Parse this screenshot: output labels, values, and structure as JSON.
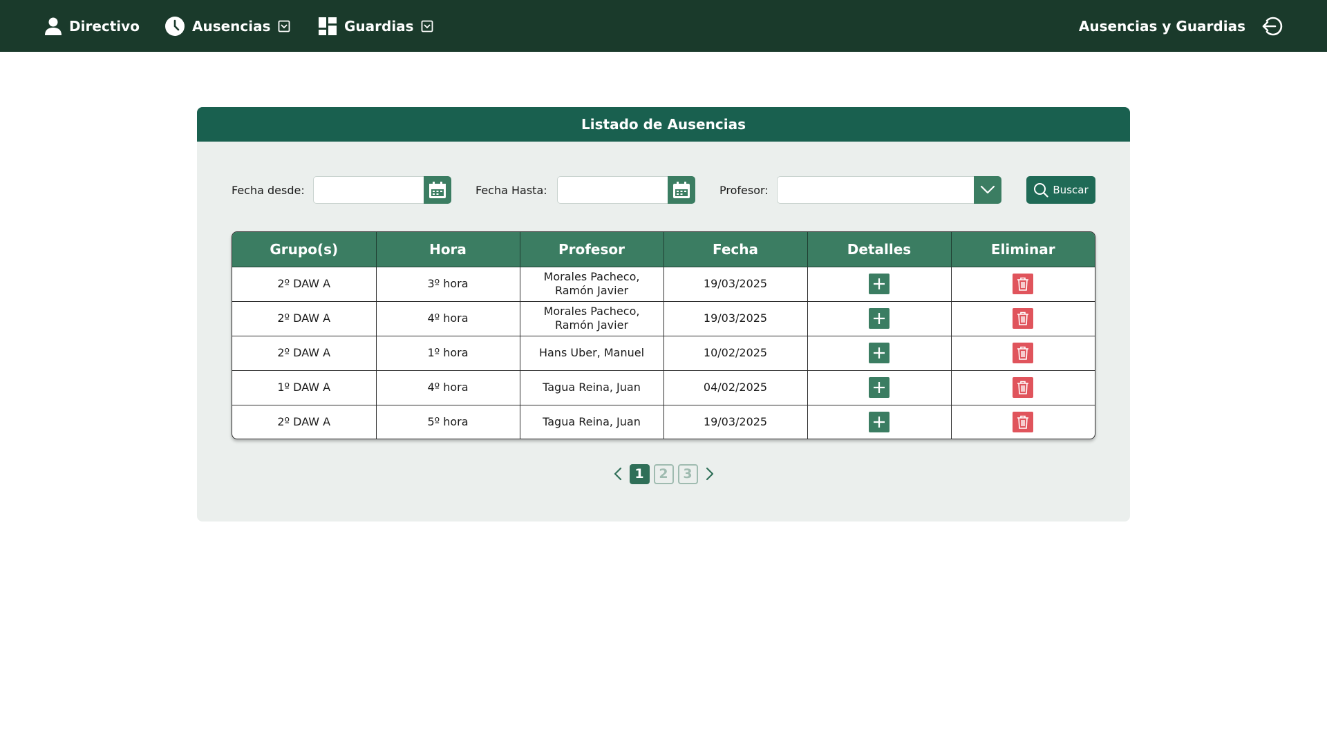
{
  "nav": {
    "directivo": "Directivo",
    "ausencias": "Ausencias",
    "guardias": "Guardias",
    "app_title": "Ausencias y Guardias"
  },
  "panel": {
    "title": "Listado de Ausencias"
  },
  "filters": {
    "fecha_desde_label": "Fecha desde:",
    "fecha_desde_value": "",
    "fecha_hasta_label": "Fecha Hasta:",
    "fecha_hasta_value": "",
    "profesor_label": "Profesor:",
    "profesor_value": "",
    "search_label": "Buscar"
  },
  "table": {
    "headers": [
      "Grupo(s)",
      "Hora",
      "Profesor",
      "Fecha",
      "Detalles",
      "Eliminar"
    ],
    "rows": [
      {
        "grupo": "2º DAW A",
        "hora": "3º hora",
        "profesor": "Morales Pacheco, Ramón Javier",
        "fecha": "19/03/2025"
      },
      {
        "grupo": "2º DAW A",
        "hora": "4º hora",
        "profesor": "Morales Pacheco, Ramón Javier",
        "fecha": "19/03/2025"
      },
      {
        "grupo": "2º DAW A",
        "hora": "1º hora",
        "profesor": "Hans Uber, Manuel",
        "fecha": "10/02/2025"
      },
      {
        "grupo": "1º DAW A",
        "hora": "4º hora",
        "profesor": "Tagua Reina, Juan",
        "fecha": "04/02/2025"
      },
      {
        "grupo": "2º DAW A",
        "hora": "5º hora",
        "profesor": "Tagua Reina, Juan",
        "fecha": "19/03/2025"
      }
    ]
  },
  "pagination": {
    "pages": [
      "1",
      "2",
      "3"
    ],
    "current": "1"
  },
  "colors": {
    "topbar": "#1a3a2b",
    "panel_header": "#19604f",
    "table_header": "#3b7d62",
    "delete": "#e0545c"
  },
  "icons": {
    "directivo": "user-icon",
    "ausencias": "clock-icon",
    "guardias": "dashboard-icon",
    "logout": "logout-icon",
    "calendar": "calendar-icon",
    "dropdown": "chevron-down-icon",
    "search": "search-icon",
    "details": "plus-icon",
    "delete": "trash-icon"
  }
}
